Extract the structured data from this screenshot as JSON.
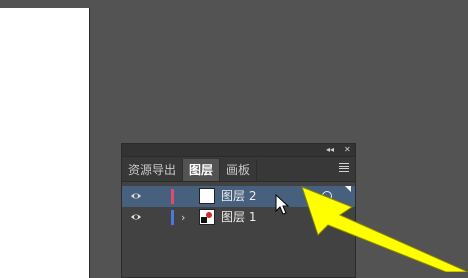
{
  "panel": {
    "topbar": {
      "collapse": "◂◂",
      "close": "✕"
    },
    "tabs": [
      {
        "label": "资源导出",
        "active": false
      },
      {
        "label": "图层",
        "active": true
      },
      {
        "label": "画板",
        "active": false
      }
    ],
    "layers": [
      {
        "name": "图层 2",
        "selected": true,
        "color": "#e24a6b",
        "expandable": false
      },
      {
        "name": "图层 1",
        "selected": false,
        "color": "#4f76e0",
        "expandable": true,
        "expander": "›"
      }
    ]
  },
  "colors": {
    "canvas": "#535353",
    "panel": "#424242",
    "selected_row": "#46607e",
    "annotation_arrow": "#ffff00"
  },
  "icons": [
    "eye-icon",
    "panel-menu-icon",
    "chevron-right-icon",
    "target-circle-icon",
    "mouse-cursor-icon",
    "annotation-arrow"
  ]
}
